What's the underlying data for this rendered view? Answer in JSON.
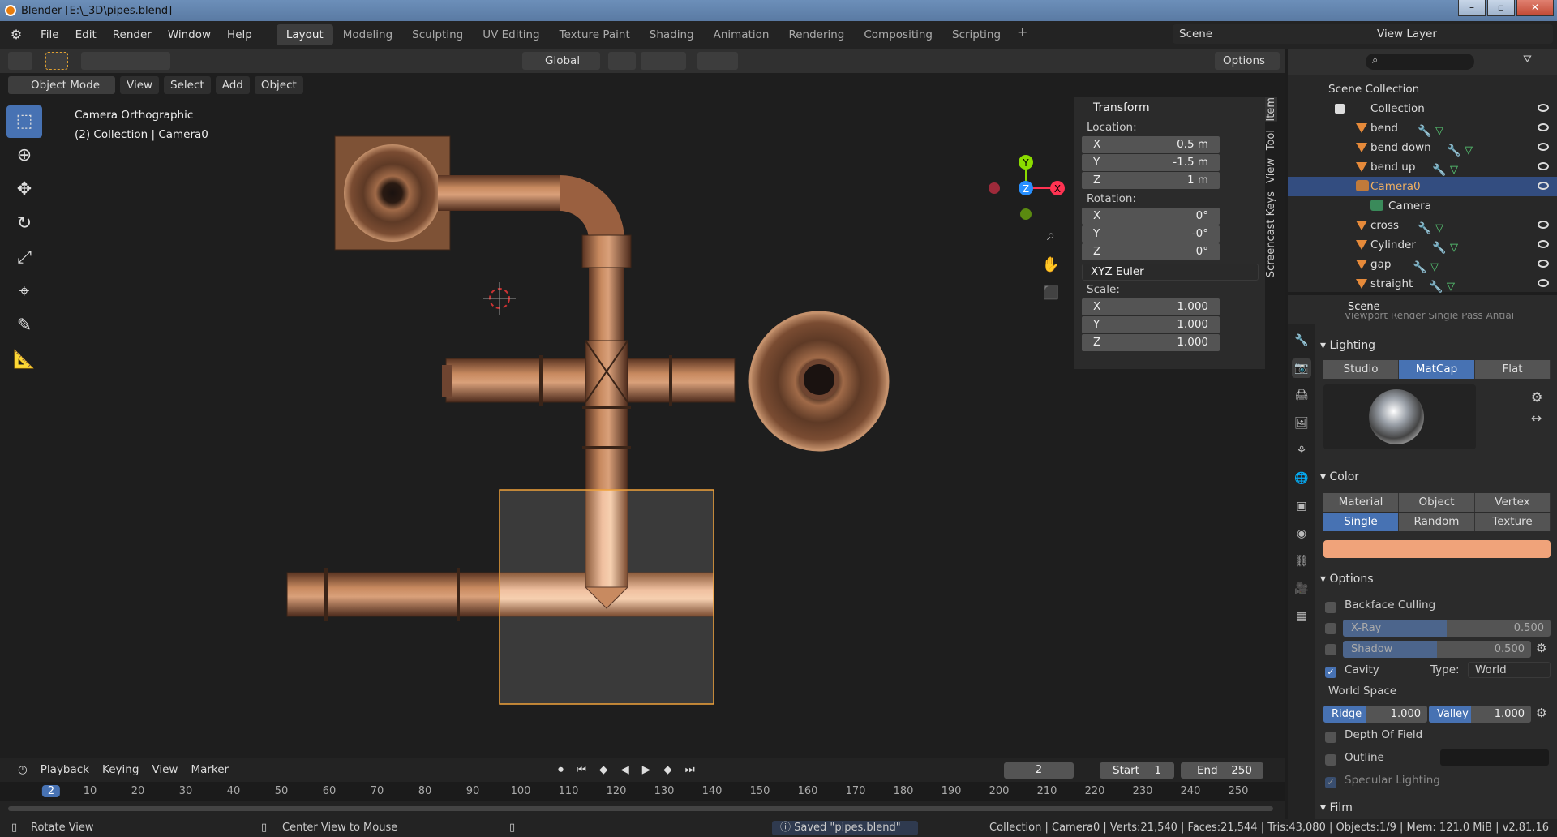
{
  "window": {
    "title": "Blender [E:\\_3D\\pipes.blend]"
  },
  "menubar": {
    "menus": [
      "File",
      "Edit",
      "Render",
      "Window",
      "Help"
    ],
    "workspaces": [
      "Layout",
      "Modeling",
      "Sculpting",
      "UV Editing",
      "Texture Paint",
      "Shading",
      "Animation",
      "Rendering",
      "Compositing",
      "Scripting"
    ],
    "active_workspace": "Layout",
    "scene": "Scene",
    "view_layer": "View Layer"
  },
  "toolheader": {
    "orientation": "Global",
    "options": "Options"
  },
  "viewport": {
    "mode": "Object Mode",
    "menus": [
      "View",
      "Select",
      "Add",
      "Object"
    ],
    "info_line1": "Camera Orthographic",
    "info_line2": "(2) Collection | Camera0",
    "gizmo_axes": {
      "x": "X",
      "y": "Y",
      "z": "Z"
    }
  },
  "transform": {
    "title": "Transform",
    "location_label": "Location:",
    "location": [
      {
        "axis": "X",
        "value": "0.5 m"
      },
      {
        "axis": "Y",
        "value": "-1.5 m"
      },
      {
        "axis": "Z",
        "value": "1 m"
      }
    ],
    "rotation_label": "Rotation:",
    "rotation": [
      {
        "axis": "X",
        "value": "0°"
      },
      {
        "axis": "Y",
        "value": "-0°"
      },
      {
        "axis": "Z",
        "value": "0°"
      }
    ],
    "rotation_mode": "XYZ Euler",
    "scale_label": "Scale:",
    "scale": [
      {
        "axis": "X",
        "value": "1.000"
      },
      {
        "axis": "Y",
        "value": "1.000"
      },
      {
        "axis": "Z",
        "value": "1.000"
      }
    ]
  },
  "sidebar_tabs": [
    "Item",
    "Tool",
    "View",
    "Screencast Keys"
  ],
  "outliner": {
    "root": "Scene Collection",
    "collection": "Collection",
    "items": [
      "bend",
      "bend down",
      "bend up",
      "Camera0",
      "Camera",
      "cross",
      "Cylinder",
      "gap",
      "straight"
    ],
    "selected": "Camera0"
  },
  "properties": {
    "header": "Scene",
    "truncated_row": "Viewport Render     Single Pass Antial",
    "lighting": {
      "title": "Lighting",
      "modes": [
        "Studio",
        "MatCap",
        "Flat"
      ],
      "active": "MatCap"
    },
    "color": {
      "title": "Color",
      "row1": [
        "Material",
        "Object",
        "Vertex"
      ],
      "row2": [
        "Single",
        "Random",
        "Texture"
      ],
      "active": "Single",
      "swatch": "#f0a37a"
    },
    "options": {
      "title": "Options",
      "backface": "Backface Culling",
      "xray": {
        "label": "X-Ray",
        "value": "0.500",
        "fraction": 0.5
      },
      "shadow": {
        "label": "Shadow",
        "value": "0.500",
        "fraction": 0.5
      },
      "cavity": "Cavity",
      "type_label": "Type:",
      "type_value": "World",
      "world_space": "World Space",
      "ridge": {
        "label": "Ridge",
        "value": "1.000"
      },
      "valley": {
        "label": "Valley",
        "value": "1.000"
      },
      "dof": "Depth Of Field",
      "outline": "Outline",
      "specular": "Specular Lighting"
    },
    "film": "Film"
  },
  "timeline": {
    "menus": [
      "Playback",
      "Keying",
      "View",
      "Marker"
    ],
    "current_frame": "2",
    "start_label": "Start",
    "start": "1",
    "end_label": "End",
    "end": "250",
    "ruler": [
      "2",
      "10",
      "20",
      "30",
      "40",
      "50",
      "60",
      "70",
      "80",
      "90",
      "100",
      "110",
      "120",
      "130",
      "140",
      "150",
      "160",
      "170",
      "180",
      "190",
      "200",
      "210",
      "220",
      "230",
      "240",
      "250"
    ]
  },
  "statusbar": {
    "left": "Rotate View",
    "middle": "Center View to Mouse",
    "message": "Saved \"pipes.blend\"",
    "stats": "Collection | Camera0 | Verts:21,540 | Faces:21,544 | Tris:43,080 | Objects:1/9 | Mem: 121.0 MiB | v2.81.16"
  },
  "colors": {
    "accent": "#4772b3",
    "selection": "#f0a23a",
    "copper": "#b8734a"
  }
}
